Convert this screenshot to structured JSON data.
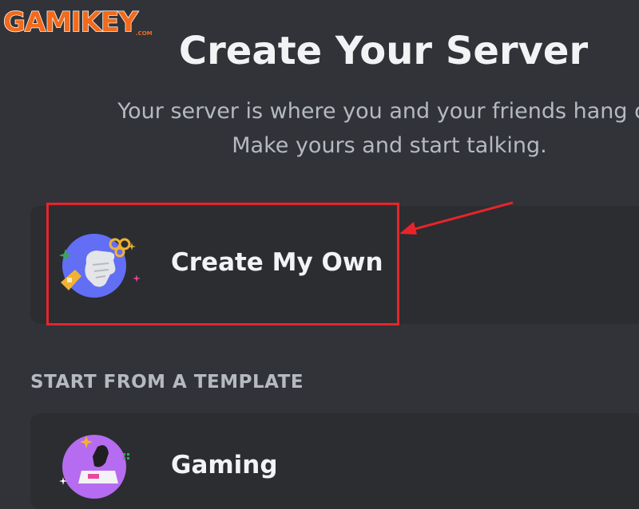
{
  "watermark": {
    "brand": "GAMIKEY",
    "suffix": ".COM",
    "color": "#f26a1b"
  },
  "modal": {
    "title": "Create Your Server",
    "subtitle_line1": "Your server is where you and your friends hang ou",
    "subtitle_line2": "Make yours and start talking."
  },
  "options": {
    "create_own": {
      "label": "Create My Own",
      "icon": "create-own-illustration-icon"
    }
  },
  "templates": {
    "heading": "START FROM A TEMPLATE",
    "items": [
      {
        "label": "Gaming",
        "icon": "gaming-illustration-icon"
      }
    ]
  },
  "annotation": {
    "highlight_color": "#e8242a",
    "arrow_color": "#e8242a"
  },
  "colors": {
    "background": "#313338",
    "card": "#2b2d31",
    "heading_text": "#f2f3f5",
    "muted_text": "#b5bac1"
  }
}
